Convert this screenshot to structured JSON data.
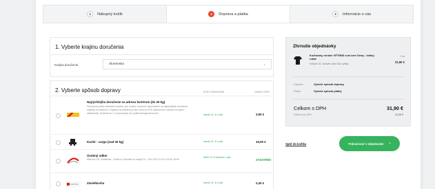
{
  "steps": [
    {
      "num": "1",
      "label": "Nákupný košík"
    },
    {
      "num": "2",
      "label": "Doprava a platba"
    },
    {
      "num": "3",
      "label": "Informácie o vás"
    }
  ],
  "section1": {
    "title": "1. Vyberte krajinu doručenia",
    "country_label": "Krajina doručenia",
    "country_value": "Slovensko"
  },
  "section2": {
    "title": "2. Vyberte spôsob dopravy",
    "col_time": "KEDY DORUČÍME",
    "col_price": "CENA S DPH",
    "rows": [
      {
        "title": "Najrýchlejšia doručenie na adresu kuriérom (do 30 kg)",
        "desc": "Doručenie podľa zvoleného kuriéra, ako vhodnú možnosť odporúčame na najrýchlejšie doručenie zásielky na dobierku. Poplatok za dobierku je ako cena od 30 € zdarma bez rozdielu na výšku objednávky. Dodanie do 1-2 pracovných dní podľa dostupnosti tovaru.",
        "time": "utorok 11. 6 u vás",
        "price": "3,90 €"
      },
      {
        "title": "Kuriér - cargo (nad 30 kg)",
        "desc": "",
        "time": "utorok 11. 6 u vás",
        "price": "15,00 €"
      },
      {
        "title": "Osobný odber",
        "desc": "Mierová 131, Bratislava - Ružinov (Zobraziť na mape) Po - Pia: 9:00-17:00 a 13:00-15:00",
        "time": "dnes 10. 6 osobne u nás",
        "price": "ZADARMO"
      },
      {
        "title": "Zásielkovňa",
        "desc": "",
        "time": "utorok 11. 6 u vás",
        "price": "2,40 €"
      }
    ]
  },
  "summary": {
    "title": "Zhrnutie objednávky",
    "product_name": "Kuchársky rondon OPTIMIS cool sem Owny - krátky rukáv",
    "product_meta": "Veľkosť: M, Vybavte oddo Sivú vybtky",
    "product_qty": "1 ks",
    "product_price": "31,90 €",
    "shipping_label": "Doprava",
    "shipping_value": "Vyberte spôsob dopravy",
    "payment_label": "Platba",
    "payment_value": "Vyberte spôsob platby",
    "total_label": "Celkom s DPH",
    "total_value": "31,90 €",
    "novat_label": "Celkom bez DPH",
    "novat_value": "26,36 €"
  },
  "actions": {
    "back_label": "Späť do košíka",
    "continue_label": "Pokračovať v objednávke"
  },
  "colors": {
    "accent": "#e8452f",
    "success": "#36b35c",
    "text_green": "#2aa44f"
  },
  "icons": [
    "chevron-down-icon",
    "chevron-right-icon",
    "shirt-icon"
  ]
}
